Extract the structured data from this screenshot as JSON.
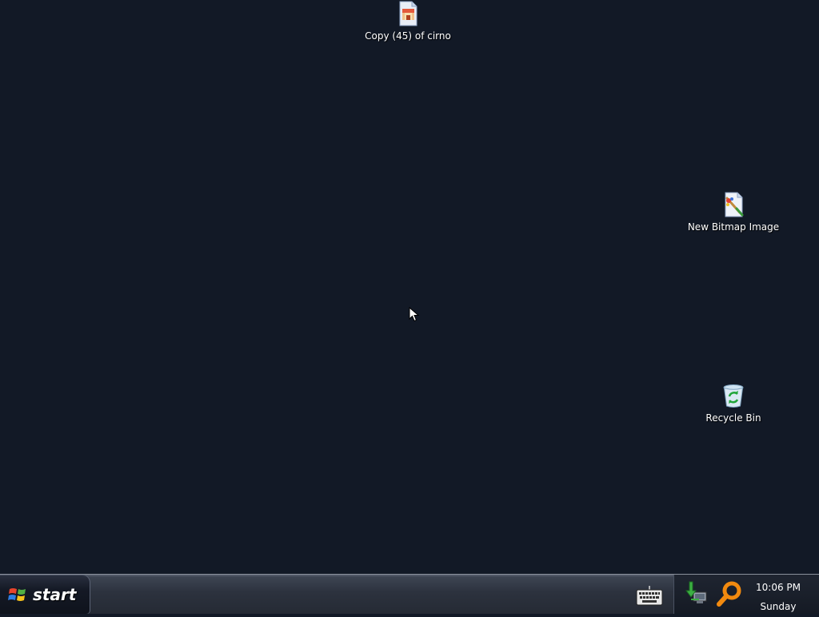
{
  "desktop": {
    "icons": [
      {
        "label": "Copy (45) of cirno",
        "icon": "image-file-icon"
      },
      {
        "label": "New Bitmap Image",
        "icon": "bitmap-paint-icon"
      },
      {
        "label": "Recycle Bin",
        "icon": "recycle-bin-icon"
      }
    ]
  },
  "taskbar": {
    "start_label": "start",
    "quick_launch": [
      {
        "icon": "keyboard-icon"
      }
    ],
    "tray": {
      "icons": [
        "network-icon",
        "search-icon"
      ],
      "time": "10:06 PM",
      "day": "Sunday"
    }
  },
  "colors": {
    "desktop_background": "#121926",
    "taskbar": "#2c323e",
    "text": "#ffffff",
    "search_accent": "#f28a0f"
  }
}
